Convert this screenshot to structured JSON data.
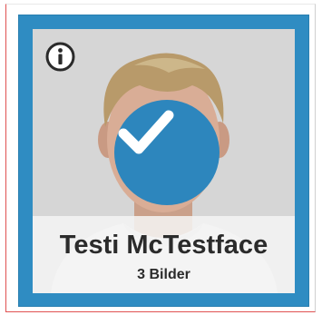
{
  "card": {
    "name": "Testi McTestface",
    "image_count_label": "3 Bilder",
    "selected": true
  },
  "icons": {
    "info": "info-icon",
    "selected": "checkmark-icon"
  },
  "colors": {
    "accent": "#2f8cc2",
    "badge": "#2d86bd",
    "caption_text": "#2b2b2b",
    "caption_bg": "#f5f5f5"
  }
}
